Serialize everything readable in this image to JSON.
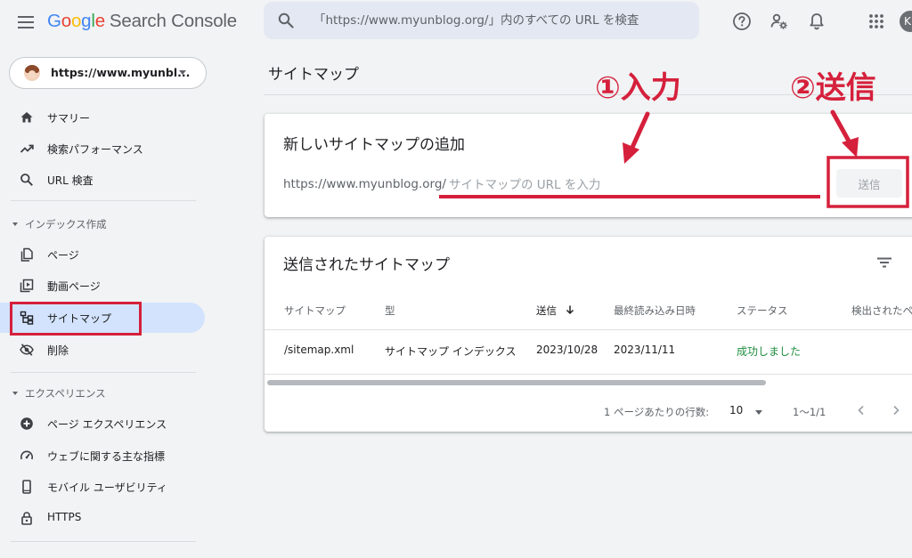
{
  "header": {
    "logo_letters": [
      "G",
      "o",
      "o",
      "g",
      "l",
      "e"
    ],
    "product": "Search Console",
    "search_placeholder": "「https://www.myunblog.org/」内のすべての URL を検査",
    "avatar_letter": "K"
  },
  "sidebar": {
    "property": "https://www.myunbl...",
    "items_top": [
      {
        "label": "サマリー",
        "icon": "home-icon"
      },
      {
        "label": "検索パフォーマンス",
        "icon": "trending-up-icon"
      },
      {
        "label": "URL 検査",
        "icon": "search-icon"
      }
    ],
    "section_index": "インデックス作成",
    "items_index": [
      {
        "label": "ページ",
        "icon": "pages-icon"
      },
      {
        "label": "動画ページ",
        "icon": "video-page-icon"
      },
      {
        "label": "サイトマップ",
        "icon": "sitemap-icon",
        "active": true
      },
      {
        "label": "削除",
        "icon": "eye-off-icon"
      }
    ],
    "section_experience": "エクスペリエンス",
    "items_experience": [
      {
        "label": "ページ エクスペリエンス",
        "icon": "add-circle-icon"
      },
      {
        "label": "ウェブに関する主な指標",
        "icon": "speed-icon"
      },
      {
        "label": "モバイル ユーザビリティ",
        "icon": "phone-icon"
      },
      {
        "label": "HTTPS",
        "icon": "lock-icon"
      }
    ]
  },
  "main": {
    "page_title": "サイトマップ",
    "add_card": {
      "title": "新しいサイトマップの追加",
      "url_prefix": "https://www.myunblog.org/",
      "input_placeholder": "サイトマップの URL を入力",
      "submit_label": "送信"
    },
    "submitted_card": {
      "title": "送信されたサイトマップ",
      "columns": [
        "サイトマップ",
        "型",
        "送信",
        "最終読み込み日時",
        "ステータス",
        "検出されたペ"
      ],
      "sorted_column": "送信",
      "rows": [
        {
          "sitemap": "/sitemap.xml",
          "type": "サイトマップ インデックス",
          "submitted": "2023/10/28",
          "last_read": "2023/11/11",
          "status": "成功しました"
        }
      ],
      "pagination": {
        "rows_per_page_label": "1 ページあたりの行数:",
        "rows_per_page_value": "10",
        "range": "1〜1/1"
      }
    }
  },
  "annotations": {
    "step1": "①入力",
    "step2": "②送信"
  },
  "colors": {
    "annotation_red": "#d5203c",
    "status_green": "#1e8e3e",
    "active_nav_bg": "#d3e3fd"
  }
}
